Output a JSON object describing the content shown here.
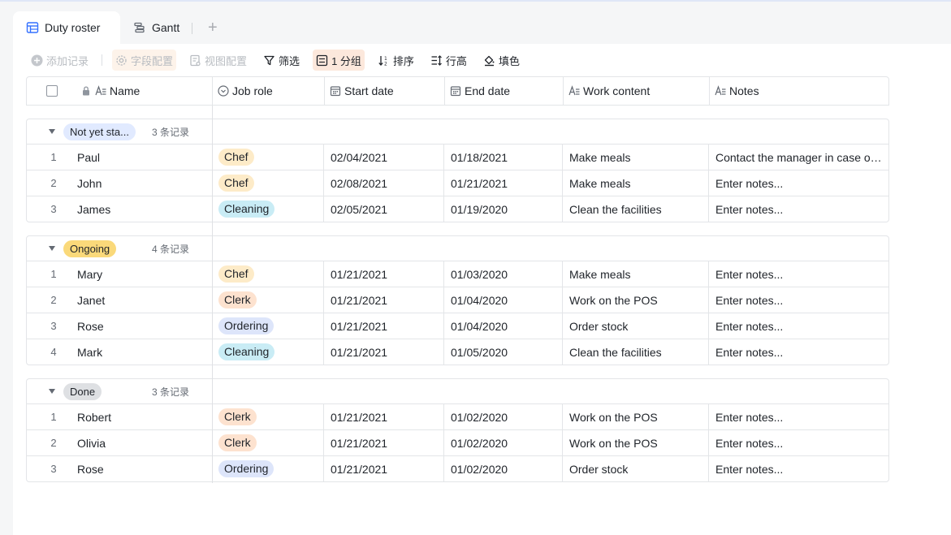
{
  "tabs": [
    {
      "label": "Duty roster",
      "icon": "table-icon",
      "active": true
    },
    {
      "label": "Gantt",
      "icon": "gantt-icon",
      "active": false
    }
  ],
  "add_tab_icon": "plus-icon",
  "toolbar": {
    "add_record": "添加记录",
    "field_config": "字段配置",
    "view_config": "视图配置",
    "filter": "筛选",
    "group": "1 分组",
    "sort": "排序",
    "row_height": "行高",
    "fill_color": "填色"
  },
  "columns": {
    "name": "Name",
    "job_role": "Job role",
    "start_date": "Start date",
    "end_date": "End date",
    "work_content": "Work content",
    "notes": "Notes"
  },
  "role_colors": {
    "Chef": {
      "bg": "#fdebc8",
      "fg": "#1f2329"
    },
    "Cleaning": {
      "bg": "#c9ecf5",
      "fg": "#1f2329"
    },
    "Clerk": {
      "bg": "#fde2cf",
      "fg": "#1f2329"
    },
    "Ordering": {
      "bg": "#dde5fa",
      "fg": "#1f2329"
    }
  },
  "groups": [
    {
      "label": "Not yet sta...",
      "count": "3 条记录",
      "tag_bg": "#e1eaff",
      "rows": [
        {
          "idx": "1",
          "name": "Paul",
          "role": "Chef",
          "start": "02/04/2021",
          "end": "01/18/2021",
          "work": "Make meals",
          "notes": "Contact the manager in case of emergency"
        },
        {
          "idx": "2",
          "name": "John",
          "role": "Chef",
          "start": "02/08/2021",
          "end": "01/21/2021",
          "work": "Make meals",
          "notes": "Enter notes..."
        },
        {
          "idx": "3",
          "name": "James",
          "role": "Cleaning",
          "start": "02/05/2021",
          "end": "01/19/2020",
          "work": "Clean the facilities",
          "notes": "Enter notes..."
        }
      ]
    },
    {
      "label": "Ongoing",
      "count": "4 条记录",
      "tag_bg": "#fad97a",
      "rows": [
        {
          "idx": "1",
          "name": "Mary",
          "role": "Chef",
          "start": "01/21/2021",
          "end": "01/03/2020",
          "work": "Make meals",
          "notes": "Enter notes..."
        },
        {
          "idx": "2",
          "name": "Janet",
          "role": "Clerk",
          "start": "01/21/2021",
          "end": "01/04/2020",
          "work": "Work on the POS",
          "notes": "Enter notes..."
        },
        {
          "idx": "3",
          "name": "Rose",
          "role": "Ordering",
          "start": "01/21/2021",
          "end": "01/04/2020",
          "work": "Order stock",
          "notes": "Enter notes..."
        },
        {
          "idx": "4",
          "name": "Mark",
          "role": "Cleaning",
          "start": "01/21/2021",
          "end": "01/05/2020",
          "work": "Clean the facilities",
          "notes": "Enter notes..."
        }
      ]
    },
    {
      "label": "Done",
      "count": "3 条记录",
      "tag_bg": "#dee0e3",
      "rows": [
        {
          "idx": "1",
          "name": "Robert",
          "role": "Clerk",
          "start": "01/21/2021",
          "end": "01/02/2020",
          "work": "Work on the POS",
          "notes": "Enter notes..."
        },
        {
          "idx": "2",
          "name": "Olivia",
          "role": "Clerk",
          "start": "01/21/2021",
          "end": "01/02/2020",
          "work": "Work on the POS",
          "notes": "Enter notes..."
        },
        {
          "idx": "3",
          "name": "Rose",
          "role": "Ordering",
          "start": "01/21/2021",
          "end": "01/02/2020",
          "work": "Order stock",
          "notes": "Enter notes..."
        }
      ]
    }
  ]
}
